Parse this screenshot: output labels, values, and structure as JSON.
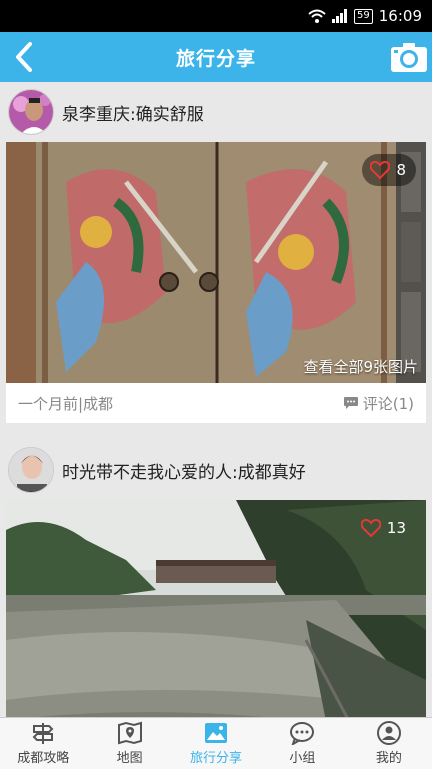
{
  "status": {
    "time": "16:09",
    "battery": "59"
  },
  "header": {
    "title": "旅行分享"
  },
  "posts": [
    {
      "title": "泉李重庆:确实舒服",
      "likes": "8",
      "view_all": "查看全部9张图片",
      "meta": "一个月前|成都",
      "comments": "评论(1)"
    },
    {
      "title": "时光带不走我心爱的人:成都真好",
      "likes": "13"
    }
  ],
  "nav": {
    "items": [
      {
        "label": "成都攻略",
        "icon": "signpost-icon"
      },
      {
        "label": "地图",
        "icon": "map-icon"
      },
      {
        "label": "旅行分享",
        "icon": "photo-icon",
        "active": true
      },
      {
        "label": "小组",
        "icon": "chat-icon"
      },
      {
        "label": "我的",
        "icon": "person-icon"
      }
    ]
  },
  "colors": {
    "accent": "#3cb4ea",
    "like": "#e53935"
  }
}
